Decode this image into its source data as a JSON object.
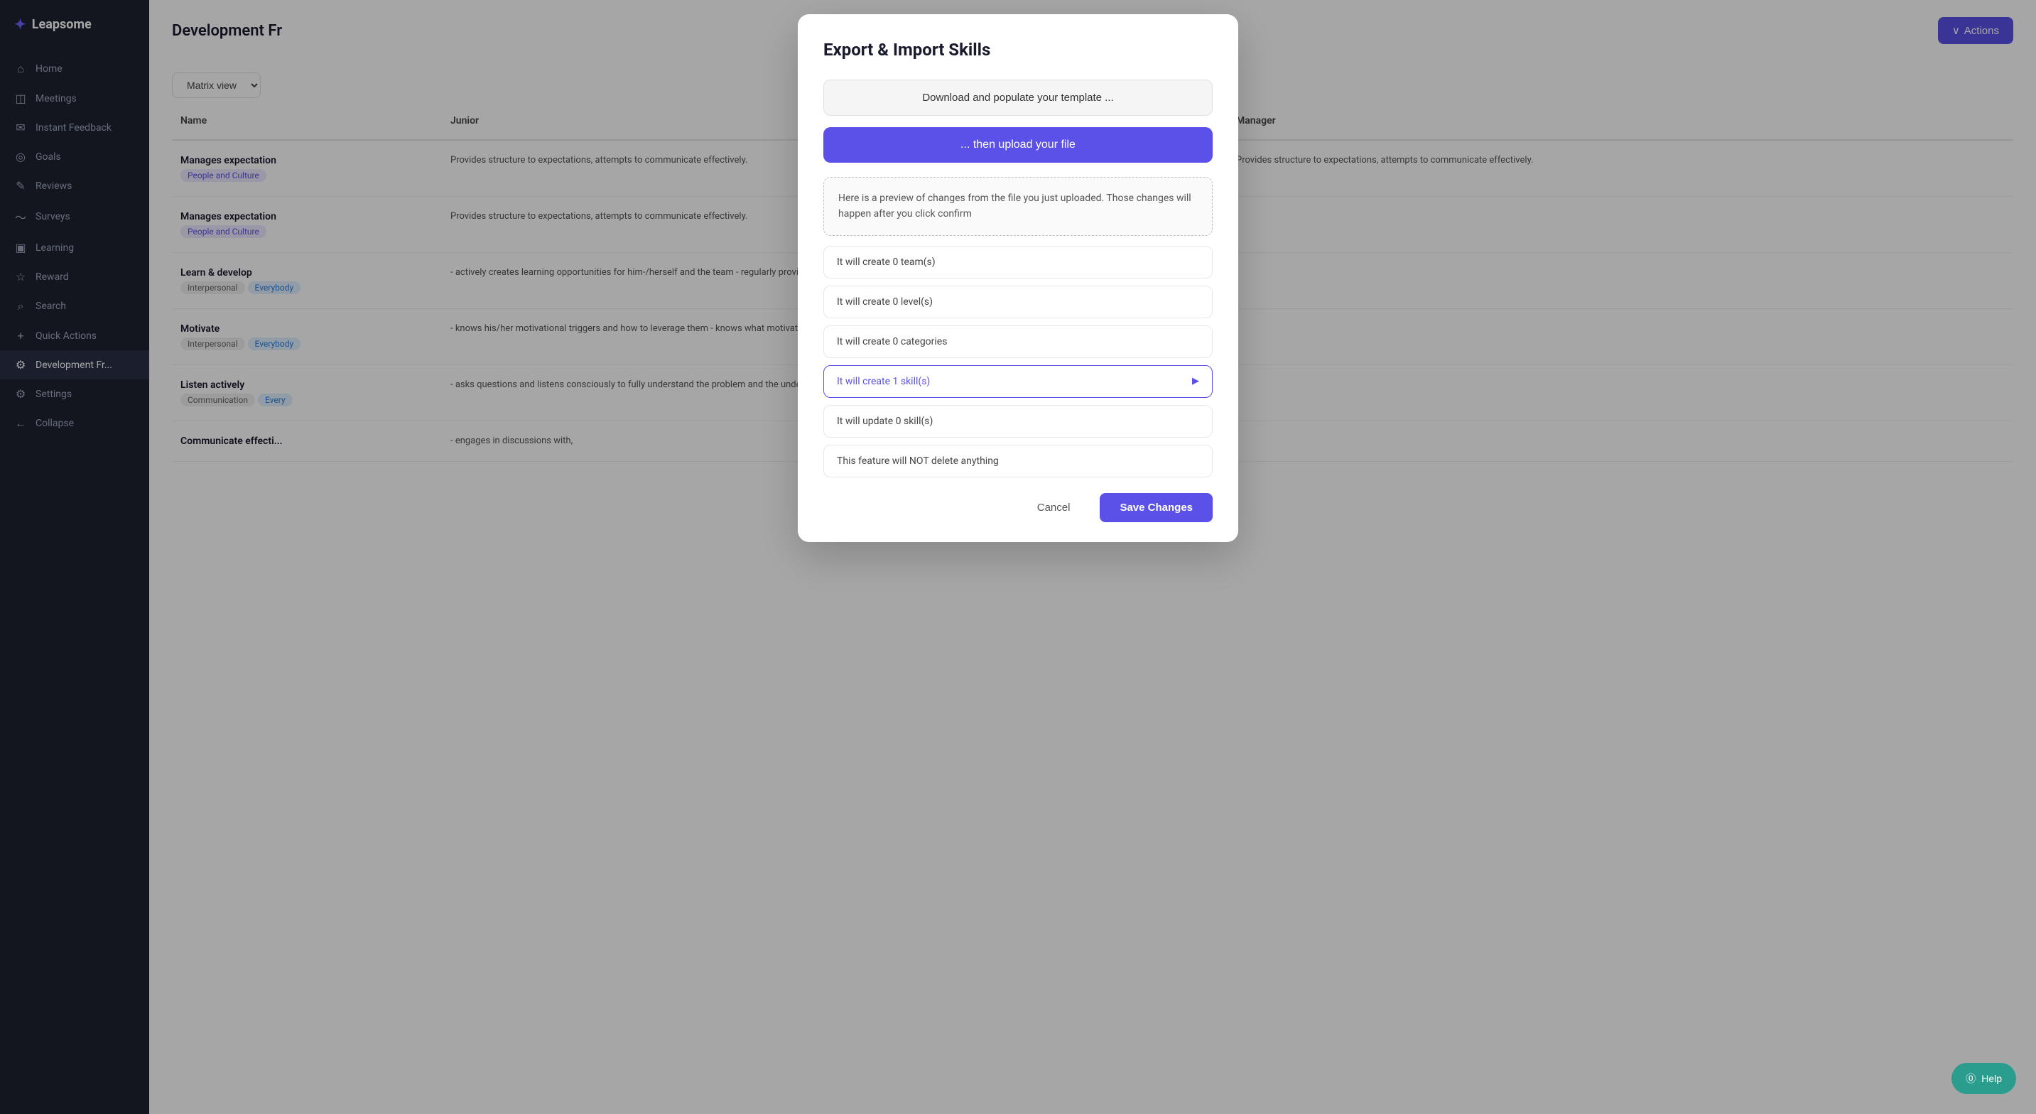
{
  "app": {
    "name": "Leapsome",
    "logo_icon": "✦"
  },
  "sidebar": {
    "items": [
      {
        "id": "home",
        "label": "Home",
        "icon": "⌂"
      },
      {
        "id": "meetings",
        "label": "Meetings",
        "icon": "◫"
      },
      {
        "id": "instant-feedback",
        "label": "Instant Feedback",
        "icon": "✉"
      },
      {
        "id": "goals",
        "label": "Goals",
        "icon": "◎"
      },
      {
        "id": "reviews",
        "label": "Reviews",
        "icon": "✎"
      },
      {
        "id": "surveys",
        "label": "Surveys",
        "icon": "〜"
      },
      {
        "id": "learning",
        "label": "Learning",
        "icon": "▣"
      },
      {
        "id": "reward",
        "label": "Reward",
        "icon": "☆"
      },
      {
        "id": "search",
        "label": "Search",
        "icon": "⌕"
      },
      {
        "id": "quick-actions",
        "label": "Quick Actions",
        "icon": "+"
      },
      {
        "id": "development",
        "label": "Development Fr...",
        "icon": "⚙",
        "active": true
      },
      {
        "id": "settings",
        "label": "Settings",
        "icon": "⚙"
      },
      {
        "id": "collapse",
        "label": "Collapse",
        "icon": "←"
      }
    ]
  },
  "header": {
    "title": "Development Fr",
    "actions_label": "Actions"
  },
  "toolbar": {
    "view_label": "Matrix view"
  },
  "table": {
    "columns": [
      "Name",
      "Junior",
      "Manager"
    ],
    "rows": [
      {
        "name": "Manages expectation",
        "tags": [
          {
            "label": "People and Culture",
            "type": "purple"
          }
        ],
        "junior": "Provides structure to expectations, attempts to communicate effectively.",
        "manager": "Provides structure to expectations, attempts to communicate effectively."
      },
      {
        "name": "Manages expectation",
        "tags": [
          {
            "label": "People and Culture",
            "type": "purple"
          }
        ],
        "junior": "Provides structure to expectations, attempts to communicate effectively.",
        "manager": ""
      },
      {
        "name": "Learn & develop",
        "tags": [
          {
            "label": "Interpersonal",
            "type": "gray"
          },
          {
            "label": "Everybody",
            "type": "blue"
          }
        ],
        "junior": "- actively creates learning opportunities for him-/herself and the team - regularly provides...",
        "manager": ""
      },
      {
        "name": "Motivate",
        "tags": [
          {
            "label": "Interpersonal",
            "type": "gray"
          },
          {
            "label": "Everybody",
            "type": "blue"
          }
        ],
        "junior": "- knows his/her motivational triggers and how to leverage them - knows what motivates...",
        "manager": ""
      },
      {
        "name": "Listen actively",
        "tags": [
          {
            "label": "Communication",
            "type": "gray"
          },
          {
            "label": "Every",
            "type": "blue"
          }
        ],
        "junior": "- asks questions and listens consciously to fully understand the problem and the underlying...",
        "manager": ""
      },
      {
        "name": "Communicate effecti...",
        "tags": [],
        "junior": "- engages in discussions with,",
        "manager": ""
      }
    ]
  },
  "modal": {
    "title": "Export & Import Skills",
    "download_btn": "Download and populate your template ...",
    "upload_btn": "... then upload your file",
    "preview_text": "Here is a preview of changes from the file you just uploaded. Those changes will happen after you click confirm",
    "info_rows": [
      {
        "text": "It will create 0 team(s)",
        "highlighted": false
      },
      {
        "text": "It will create 0 level(s)",
        "highlighted": false
      },
      {
        "text": "It will create 0 categories",
        "highlighted": false
      },
      {
        "text": "It will create 1 skill(s)",
        "highlighted": true,
        "expand": true
      },
      {
        "text": "It will update 0 skill(s)",
        "highlighted": false
      },
      {
        "text": "This feature will NOT delete anything",
        "highlighted": false
      }
    ],
    "cancel_label": "Cancel",
    "save_label": "Save Changes"
  },
  "help": {
    "label": "Help",
    "icon": "?"
  }
}
